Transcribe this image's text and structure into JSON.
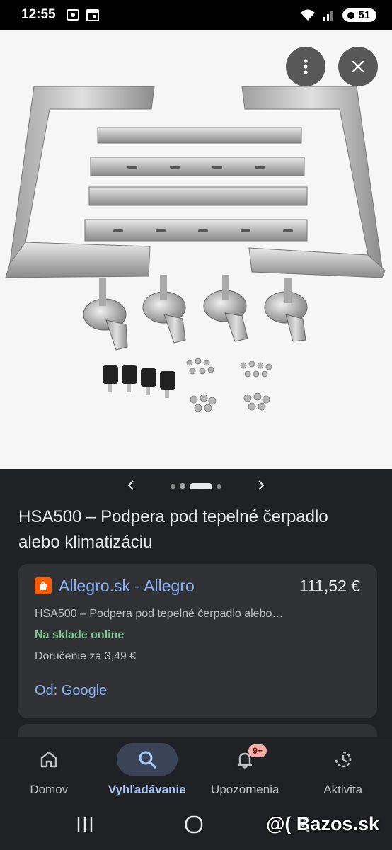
{
  "status_bar": {
    "time": "12:55",
    "battery": "51"
  },
  "viewer": {
    "menu_icon": "more-vert-icon",
    "close_icon": "close-icon",
    "image_alt": "Product image: stainless steel heat pump support frame with brackets, feet and hardware",
    "carousel": {
      "dot_count": 4,
      "active_index": 2
    }
  },
  "product": {
    "title": "HSA500 – Podpera pod tepelné čerpadlo alebo klimatizáciu"
  },
  "offer": {
    "merchant": "Allegro.sk - Allegro",
    "price": "111,52 €",
    "description": "HSA500 – Podpera pod tepelné čerpadlo alebo…",
    "stock": "Na sklade online",
    "delivery": "Doručenie za 3,49 €",
    "source": "Od: Google",
    "colors": {
      "stock": "#81c995",
      "link": "#8ab4f8",
      "favicon": "#ff5a00"
    }
  },
  "bottom_nav": {
    "items": [
      {
        "label": "Domov",
        "icon": "home-icon"
      },
      {
        "label": "Vyhľadávanie",
        "icon": "search-icon"
      },
      {
        "label": "Upozornenia",
        "icon": "bell-icon",
        "badge": "9+"
      },
      {
        "label": "Aktivita",
        "icon": "activity-icon"
      }
    ],
    "active_index": 1
  },
  "watermark": "@( Bazos.sk"
}
